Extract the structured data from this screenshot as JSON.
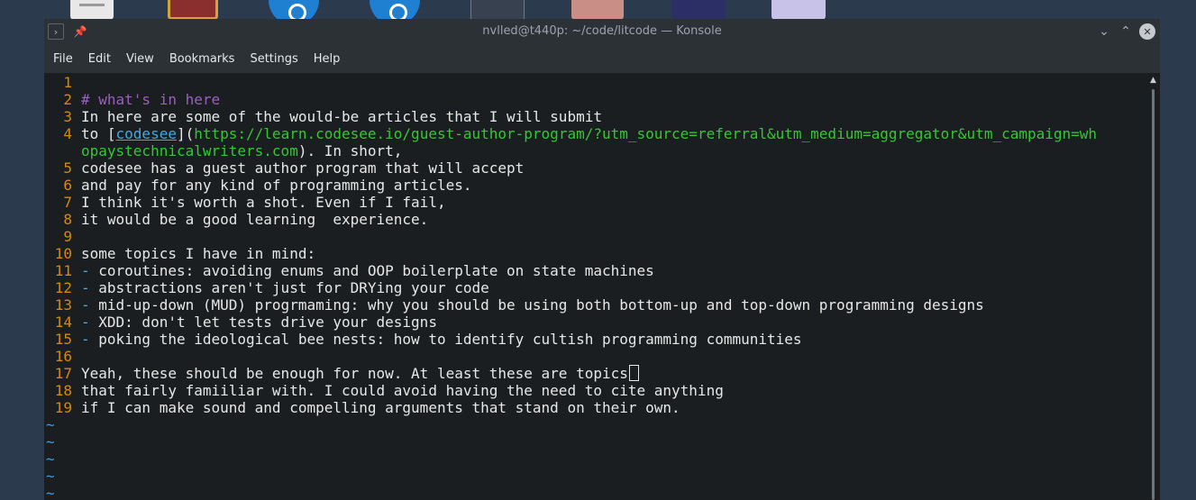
{
  "window": {
    "title": "nvlled@t440p: ~/code/litcode — Konsole",
    "menu": [
      "File",
      "Edit",
      "View",
      "Bookmarks",
      "Settings",
      "Help"
    ]
  },
  "editor": {
    "lines": {
      "n1": "1",
      "n2": "2",
      "l2": "# what's in here",
      "n3": "3",
      "l3": "In here are some of the would-be articles that I will submit",
      "n4": "4",
      "l4_prefix": "to [",
      "l4_link": "codesee",
      "l4_mid": "](",
      "l4_url": "https://learn.codesee.io/guest-author-program/?utm_source=referral&utm_medium=aggregator&utm_campaign=wh",
      "l4b_url": "opaystechnicalwriters.com",
      "l4b_rest": "). In short,",
      "n5": "5",
      "l5": "codesee has a guest author program that will accept",
      "n6": "6",
      "l6": "and pay for any kind of programming articles.",
      "n7": "7",
      "l7": "I think it's worth a shot. Even if I fail,",
      "n8": "8",
      "l8": "it would be a good learning  experience.",
      "n9": "9",
      "n10": "10",
      "l10": "some topics I have in mind:",
      "n11": "11",
      "l11": "coroutines: avoiding enums and OOP boilerplate on state machines",
      "n12": "12",
      "l12": "abstractions aren't just for DRYing your code",
      "n13": "13",
      "l13": "mid-up-down (MUD) progrmaming: why you should be using both bottom-up and top-down programming designs",
      "n14": "14",
      "l14": "XDD: don't let tests drive your designs",
      "n15": "15",
      "l15": "poking the ideological bee nests: how to identify cultish programming communities",
      "n16": "16",
      "n17": "17",
      "l17": "Yeah, these should be enough for now. At least these are topics",
      "n18": "18",
      "l18": "that fairly famiiliar with. I could avoid having the need to cite anything",
      "n19": "19",
      "l19": "if I can make sound and compelling arguments that stand on their own.",
      "bullet": "- ",
      "tilde": "~"
    }
  },
  "colors": {
    "line_numbers": "#d6890a",
    "heading": "#9a5fc0",
    "link": "#3ea9e6",
    "url": "#32c832",
    "bullet": "#4fb0e8",
    "tilde": "#3b9fe0"
  }
}
